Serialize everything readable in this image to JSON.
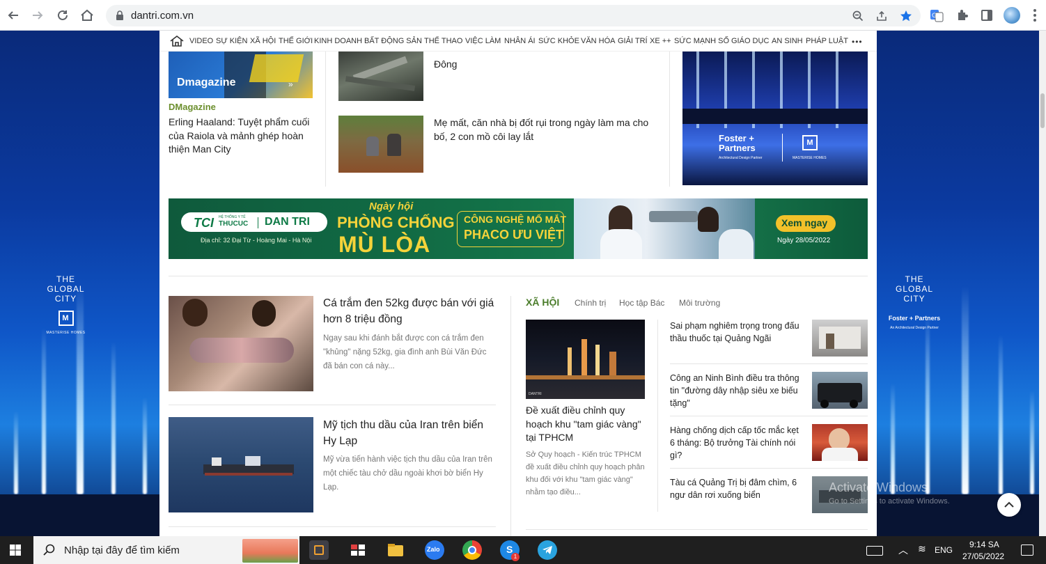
{
  "browser": {
    "url": "dantri.com.vn"
  },
  "nav": {
    "categories": [
      "VIDEO",
      "SỰ KIỆN",
      "XÃ HỘI",
      "THẾ GIỚI",
      "KINH DOANH",
      "BẤT ĐỘNG SẢN",
      "THỂ THAO",
      "VIỆC LÀM",
      "NHÂN ÁI",
      "SỨC KHỎE",
      "VĂN HÓA",
      "GIẢI TRÍ",
      "XE ++",
      "SỨC MẠNH SỐ",
      "GIÁO DỤC",
      "AN SINH",
      "PHÁP LUẬT"
    ],
    "more": "•••"
  },
  "top": {
    "dmag_thumb_label": "Dmagazine",
    "dmag_label": "DMagazine",
    "dmag_title": "Erling Haaland: Tuyệt phẩm cuối của Raiola và mảnh ghép hoàn thiện Man City",
    "story1_title": "Đông",
    "story2_title": "Mẹ mất, căn nhà bị đốt rụi trong ngày làm ma cho bố, 2 con mồ côi lay lắt",
    "ad_brand1": "Foster + Partners",
    "ad_brand1_sub": "Architectural Design Partner",
    "ad_brand2": "MASTERISE HOMES"
  },
  "banner": {
    "brand_tci": "TCI",
    "brand_system": "HỆ THỐNG Y TẾ",
    "brand_thucuc": "THUCUC",
    "brand_dantri": "DAN TRI",
    "address": "Địa chỉ: 32 Đại Từ - Hoàng Mai - Hà Nội",
    "headline1": "Ngày hội",
    "headline2": "PHÒNG CHỐNG",
    "headline3": "MÙ LÒA",
    "tech1": "CÔNG NGHỆ MỔ MẮT",
    "tech2": "PHACO ƯU VIỆT",
    "cta": "Xem ngay",
    "date": "Ngày 28/05/2022"
  },
  "articles": [
    {
      "title": "Cá trắm đen 52kg được bán với giá hơn 8 triệu đồng",
      "desc": "Ngay sau khi đánh bắt được con cá trắm đen \"khủng\" nặng 52kg, gia đình anh Bùi Văn Đức đã bán con cá này..."
    },
    {
      "title": "Mỹ tịch thu dầu của Iran trên biển Hy Lạp",
      "desc": "Mỹ vừa tiến hành việc tịch thu dầu của Iran trên một chiếc tàu chở dầu ngoài khơi bờ biển Hy Lạp."
    }
  ],
  "xahoi": {
    "heading": "XÃ HỘI",
    "subtabs": [
      "Chính trị",
      "Học tập Bác",
      "Môi trường"
    ],
    "main_thumb_tag": "DANTRI",
    "main_title": "Đề xuất điều chỉnh quy hoạch khu \"tam giác vàng\" tại TPHCM",
    "main_desc": "Sở Quy hoạch - Kiến trúc TPHCM đề xuất điều chỉnh quy hoạch phân khu đối với khu \"tam giác vàng\" nhằm tạo điều...",
    "list": [
      "Sai phạm nghiêm trọng trong đấu thầu thuốc tại Quảng Ngãi",
      "Công an Ninh Bình điều tra thông tin \"đường dây nhập siêu xe biếu tặng\"",
      "Hàng chống dịch cấp tốc mắc kẹt 6 tháng: Bộ trưởng Tài chính nói gì?",
      "Tàu cá Quảng Trị bị đâm chìm, 6 ngư dân rơi xuống biển"
    ]
  },
  "skin": {
    "line1": "THE",
    "line2": "GLOBAL",
    "line3": "CITY",
    "logo": "M",
    "sub": "MASTERISE HOMES",
    "right_brand": "Foster + Partners",
    "right_sub": "An Architectural Design Partner"
  },
  "watermark": {
    "title": "Activate Windows",
    "sub": "Go to Settings to activate Windows."
  },
  "taskbar": {
    "search_placeholder": "Nhập tại đây để tìm kiếm",
    "lang": "ENG",
    "time": "9:14 SA",
    "date": "27/05/2022",
    "zalo": "Zalo",
    "badge": "1"
  }
}
